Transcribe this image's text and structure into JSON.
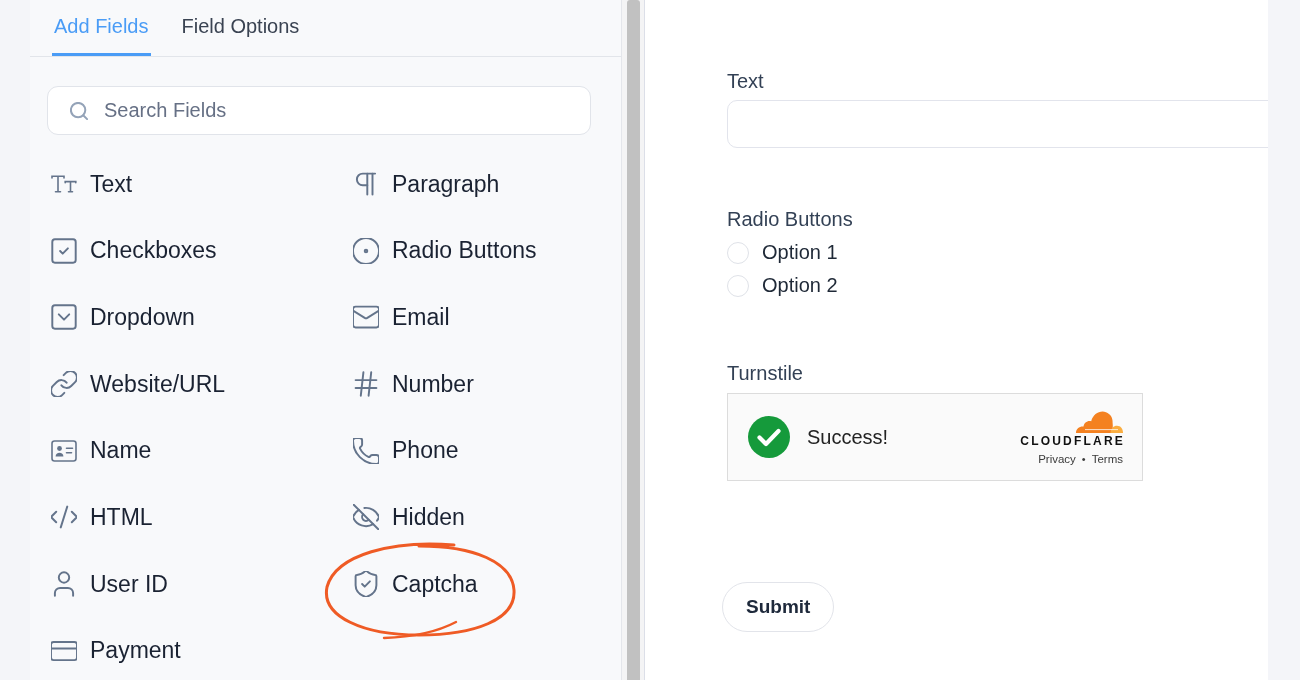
{
  "sidebar": {
    "tabs": [
      {
        "label": "Add Fields",
        "selected": true
      },
      {
        "label": "Field Options",
        "selected": false
      }
    ],
    "search": {
      "placeholder": "Search Fields"
    },
    "fields": [
      {
        "kind": "text",
        "label": "Text",
        "highlighted": false
      },
      {
        "kind": "paragraph",
        "label": "Paragraph",
        "highlighted": false
      },
      {
        "kind": "checkbox",
        "label": "Checkboxes",
        "highlighted": false
      },
      {
        "kind": "radio",
        "label": "Radio Buttons",
        "highlighted": false
      },
      {
        "kind": "dropdown",
        "label": "Dropdown",
        "highlighted": false
      },
      {
        "kind": "email",
        "label": "Email",
        "highlighted": false
      },
      {
        "kind": "url",
        "label": "Website/URL",
        "highlighted": false
      },
      {
        "kind": "number",
        "label": "Number",
        "highlighted": false
      },
      {
        "kind": "name",
        "label": "Name",
        "highlighted": false
      },
      {
        "kind": "phone",
        "label": "Phone",
        "highlighted": false
      },
      {
        "kind": "html",
        "label": "HTML",
        "highlighted": false
      },
      {
        "kind": "hidden",
        "label": "Hidden",
        "highlighted": false
      },
      {
        "kind": "userid",
        "label": "User ID",
        "highlighted": false
      },
      {
        "kind": "captcha",
        "label": "Captcha",
        "highlighted": true
      },
      {
        "kind": "payment",
        "label": "Payment",
        "highlighted": false
      }
    ]
  },
  "form": {
    "fields": [
      {
        "kind": "text",
        "label": "Text"
      },
      {
        "kind": "radio",
        "label": "Radio Buttons",
        "options": [
          {
            "label": "Option 1",
            "selected": false
          },
          {
            "label": "Option 2",
            "selected": false
          }
        ]
      },
      {
        "kind": "turnstile",
        "label": "Turnstile",
        "verified": true,
        "status": "Success!",
        "brand": "CLOUDFLARE",
        "links": [
          "Privacy",
          "Terms"
        ],
        "separator": "•"
      }
    ],
    "submit": {
      "label": "Submit"
    }
  }
}
